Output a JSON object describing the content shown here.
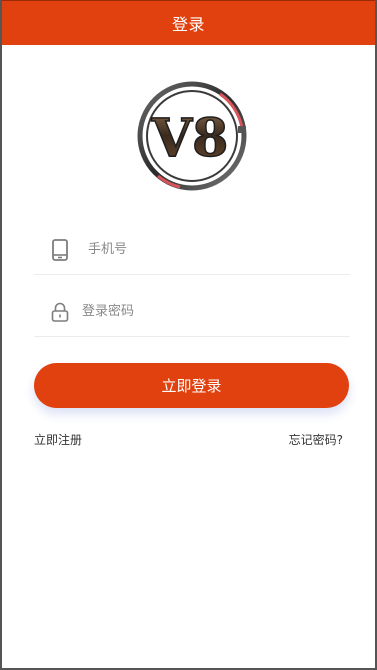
{
  "header": {
    "title": "登录"
  },
  "logo": {
    "text": "V8"
  },
  "form": {
    "phone": {
      "placeholder": "手机号",
      "value": "",
      "icon": "phone-icon"
    },
    "password": {
      "placeholder": "登录密码",
      "value": "",
      "icon": "lock-icon"
    }
  },
  "actions": {
    "login_label": "立即登录",
    "register_label": "立即注册",
    "forgot_label": "忘记密码?"
  },
  "colors": {
    "accent": "#e1410f",
    "divider": "#ececec"
  }
}
